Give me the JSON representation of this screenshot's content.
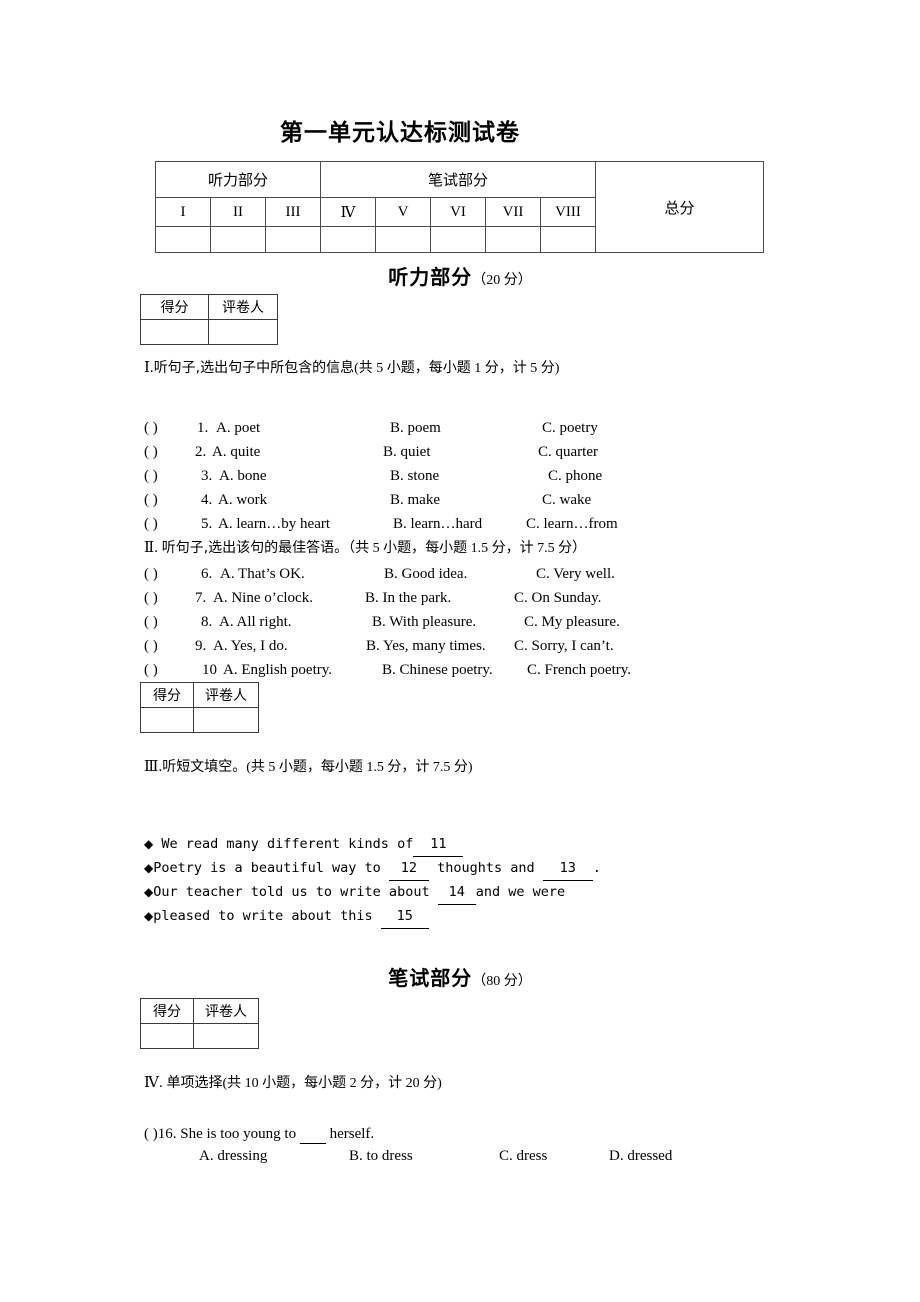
{
  "document": {
    "title": "第一单元认达标测试卷"
  },
  "summary_table": {
    "group_headers": [
      {
        "label": "听力部分",
        "span": 3
      },
      {
        "label": "笔试部分",
        "span": 5
      },
      {
        "label": "总分",
        "span": 1
      }
    ],
    "numerals": [
      "I",
      "II",
      "III",
      "Ⅳ",
      "V",
      "VI",
      "VII",
      "VIII"
    ],
    "blank_row": [
      "",
      "",
      "",
      "",
      "",
      "",
      "",
      ""
    ]
  },
  "grader_box": {
    "score_label": "得分",
    "marker_label": "评卷人"
  },
  "listening_section": {
    "banner_title": "听力部分",
    "banner_points": "（20 分）",
    "part1": {
      "heading_roman": "Ⅰ.",
      "heading_zh": "听句子,选出句子中所包含的信息",
      "heading_points": "(共 5 小题，每小题 1 分，计 5 分)",
      "questions": [
        {
          "bracket": "(      )",
          "number": "1.",
          "a": "A.  poet",
          "b": "B.  poem",
          "c": "C. poetry"
        },
        {
          "bracket": "(      )",
          "number": "2.",
          "a": "A.  quite",
          "b": "B.  quiet",
          "c": "C.  quarter"
        },
        {
          "bracket": "(      )",
          "number": "3.",
          "a": "A.  bone",
          "b": "B.  stone",
          "c": "C. phone"
        },
        {
          "bracket": "(      )",
          "number": "4.",
          "a": "A.  work",
          "b": "B.  make",
          "c": "C.  wake"
        },
        {
          "bracket": "(      )",
          "number": "5.",
          "a": "A.  learn…by heart",
          "b": "B.  learn…hard",
          "c": "C.  learn…from"
        }
      ]
    },
    "part2": {
      "heading_roman": "Ⅱ.",
      "heading_zh": "听句子,选出该句的最佳答语。",
      "heading_points": "（共 5 小题，每小题 1.5 分，计 7.5 分）",
      "questions": [
        {
          "bracket": "(      )",
          "number": "6.",
          "a": "A.  That’s  OK.",
          "b": "B.  Good idea.",
          "c": "C.  Very well."
        },
        {
          "bracket": "(      )",
          "number": "7.",
          "a": "A.  Nine o’clock.",
          "b": "B.  In the park.",
          "c": "C.  On Sunday."
        },
        {
          "bracket": "(      )",
          "number": "8.",
          "a": "A.  All right.",
          "b": "B.  With pleasure.",
          "c": "C.  My pleasure."
        },
        {
          "bracket": "(      )",
          "number": "9.",
          "a": "A.  Yes, I do.",
          "b": "B.  Yes, many times.",
          "c": "C.  Sorry, I  can’t."
        },
        {
          "bracket": "(      )",
          "number": "10",
          "a": "A.  English poetry.",
          "b": "B. Chinese poetry.",
          "c": "C.  French poetry."
        }
      ]
    },
    "part3": {
      "heading_roman": "Ⅲ.",
      "heading_zh": "听短文填空。",
      "heading_points": "(共 5 小题，每小题 1.5 分，计 7.5 分)",
      "lines": [
        {
          "bullet": "◆",
          "pre": " We read many different kinds of",
          "blank1": "11",
          "mid": "",
          "blank2": "",
          "post": ""
        },
        {
          "bullet": "◆",
          "pre": "Poetry is a beautiful way to ",
          "blank1": "12",
          "mid": " thoughts and ",
          "blank2": "13",
          "post": "."
        },
        {
          "bullet": "◆",
          "pre": "Our teacher told us to write about ",
          "blank1": "14",
          "mid": "and we were",
          "blank2": "",
          "post": ""
        },
        {
          "bullet": "◆",
          "pre": "pleased to write about this ",
          "blank1": "15",
          "mid": "",
          "blank2": "",
          "post": ""
        }
      ]
    }
  },
  "written_section": {
    "banner_title": "笔试部分",
    "banner_points": "（80 分）",
    "part4": {
      "heading_roman": "Ⅳ.",
      "heading_zh": "单项选择",
      "heading_points": "(共 10 小题，每小题 2 分，计 20 分)",
      "questions": [
        {
          "bracket": "(     )",
          "number": "16.",
          "stem_pre": "She is too young to ",
          "stem_post": " herself.",
          "a": "A.  dressing",
          "b": "B.  to dress",
          "c": "C.  dress",
          "d": "D.  dressed"
        }
      ]
    }
  }
}
